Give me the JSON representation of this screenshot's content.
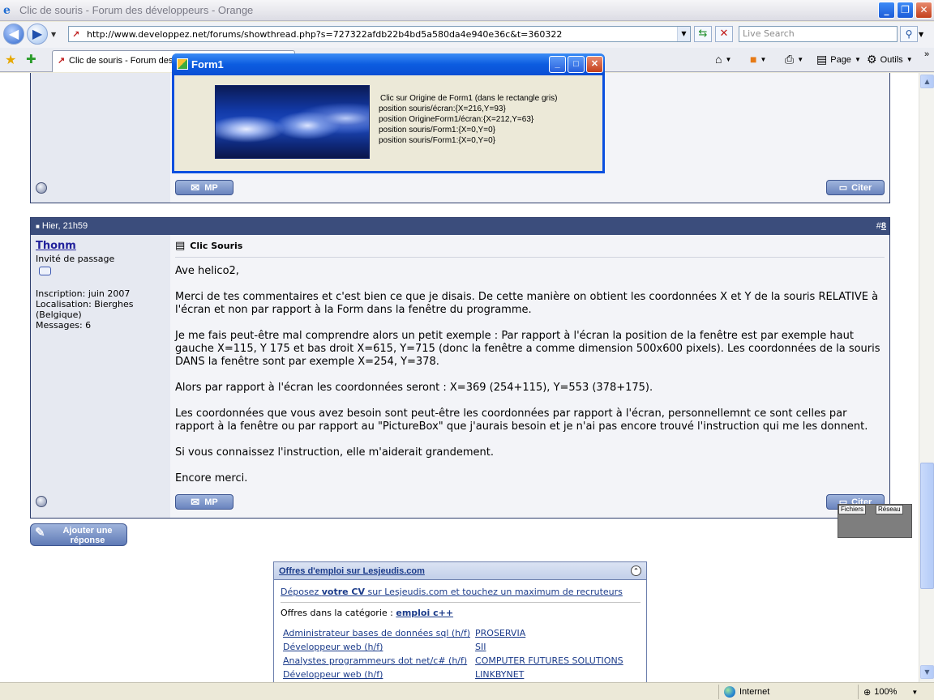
{
  "window": {
    "title": "Clic de souris - Forum des développeurs - Orange",
    "controls": {
      "minimize": "_",
      "maximize": "❐",
      "close": "✕"
    }
  },
  "toolbar": {
    "url": "http://www.developpez.net/forums/showthread.php?s=727322afdb22b4bd5a580da4e940e36c&t=360322",
    "search_placeholder": "Live Search",
    "back_icon": "back-arrow-icon",
    "forward_icon": "forward-arrow-icon"
  },
  "tabs": {
    "active_label": "Clic de souris - Forum des développeurs - Orange",
    "commands": {
      "page": "Page",
      "tools": "Outils"
    }
  },
  "post1": {
    "mp_label": "MP",
    "cite_label": "Citer"
  },
  "post2": {
    "date": "Hier, 21h59",
    "post_number_prefix": "#",
    "post_number": "8",
    "username": "Thonm",
    "user_title": "Invité de passage",
    "inscription": "Inscription: juin 2007",
    "localisation": "Localisation: Bierghes (Belgique)",
    "messages": "Messages: 6",
    "title": "Clic Souris",
    "paragraphs": [
      "Ave helico2,",
      "Merci de tes commentaires et c'est bien ce que je disais. De cette manière on obtient les coordonnées X et Y de la souris RELATIVE à l'écran et non par rapport à la Form dans la fenêtre du programme.",
      "Je me fais peut-être mal comprendre alors un petit exemple : Par rapport à l'écran la position de la fenêtre est par exemple haut gauche X=115, Y 175 et bas droit X=615, Y=715 (donc la fenêtre a comme dimension 500x600 pixels). Les coordonnées de la souris DANS la fenêtre sont par exemple X=254, Y=378.",
      "Alors par rapport à l'écran les coordonnées seront : X=369 (254+115), Y=553 (378+175).",
      "Les coordonnées que vous avez besoin sont peut-être les coordonnées par rapport à l'écran, personnellemnt ce sont celles par rapport à la fenêtre ou par rapport au \"PictureBox\" que j'aurais besoin et je n'ai pas encore trouvé l'instruction qui me les donnent.",
      "Si vous connaissez l'instruction, elle m'aiderait grandement.",
      "Encore merci."
    ],
    "mp_label": "MP",
    "cite_label": "Citer"
  },
  "reply_button": {
    "line1": "Ajouter une",
    "line2": "réponse"
  },
  "jobs": {
    "header": "Offres d'emploi sur Lesjeudis.com",
    "cv_pre": "Déposez ",
    "cv_bold": "votre CV",
    "cv_post": " sur Lesjeudis.com et touchez un maximum de recruteurs",
    "category_label": "Offres dans la catégorie : ",
    "category_link": "emploi c++",
    "offers": [
      {
        "title": "Administrateur bases de données sql (h/f)",
        "company": "PROSERVIA"
      },
      {
        "title": "Développeur web (h/f)",
        "company": "SII"
      },
      {
        "title": "Analystes programmeurs dot net/c# (h/f)",
        "company": "COMPUTER FUTURES SOLUTIONS"
      },
      {
        "title": "Développeur web (h/f)",
        "company": "LINKBYNET"
      }
    ]
  },
  "form1": {
    "title": "Form1",
    "lines": [
      "Clic sur Origine de Form1 (dans le rectangle gris)",
      "position souris/écran:{X=216,Y=93}",
      "position OrigineForm1/écran:{X=212,Y=63}",
      "position souris/Form1:{X=0,Y=0}",
      "position souris/Form1:{X=0,Y=0}"
    ]
  },
  "net_widget": {
    "tab1": "Fichiers",
    "tab2": "Réseau"
  },
  "status": {
    "zone": "Internet",
    "zoom": "100%"
  }
}
